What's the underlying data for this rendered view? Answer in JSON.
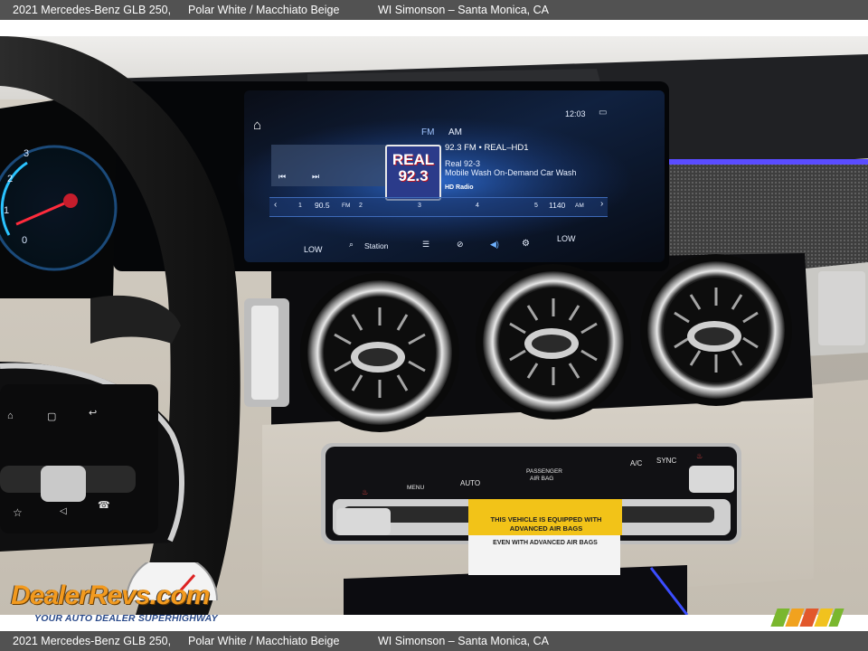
{
  "caption": {
    "vehicle": "2021 Mercedes-Benz GLB 250,",
    "colors": "Polar White / Macchiato Beige",
    "dealer": "WI Simonson – Santa Monica, CA"
  },
  "infotainment": {
    "clock": "12:03",
    "band_fm": "FM",
    "band_am": "AM",
    "station_title": "92.3 FM • REAL–HD1",
    "station_name": "Real 92-3",
    "now_playing": "Mobile Wash On-Demand Car Wash",
    "hd_badge": "HD Radio",
    "logo_line1": "REAL",
    "logo_line2": "92.3",
    "preset_1": "1",
    "preset_1_freq": "90.5",
    "preset_2": "2",
    "preset_3": "3",
    "preset_4": "4",
    "preset_5": "5",
    "preset_5_freq": "1140",
    "preset_fm": "FM",
    "preset_am": "AM",
    "station_button": "Station",
    "left_low": "LOW",
    "right_low": "LOW"
  },
  "climate": {
    "menu": "MENU",
    "auto": "AUTO",
    "passenger_airbag_1": "PASSENGER",
    "passenger_airbag_2": "AIR BAG",
    "ac": "A/C",
    "sync": "SYNC"
  },
  "airbag_warning": {
    "line1": "THIS VEHICLE IS EQUIPPED WITH",
    "line2": "ADVANCED AIR BAGS",
    "line3": "EVEN WITH ADVANCED AIR BAGS"
  },
  "gauge": {
    "n1": "3",
    "n2": "2",
    "n3": "1",
    "n4": "0"
  },
  "watermark": {
    "brand": "DealerRevs.com",
    "tagline": "YOUR AUTO DEALER SUPERHIGHWAY"
  }
}
